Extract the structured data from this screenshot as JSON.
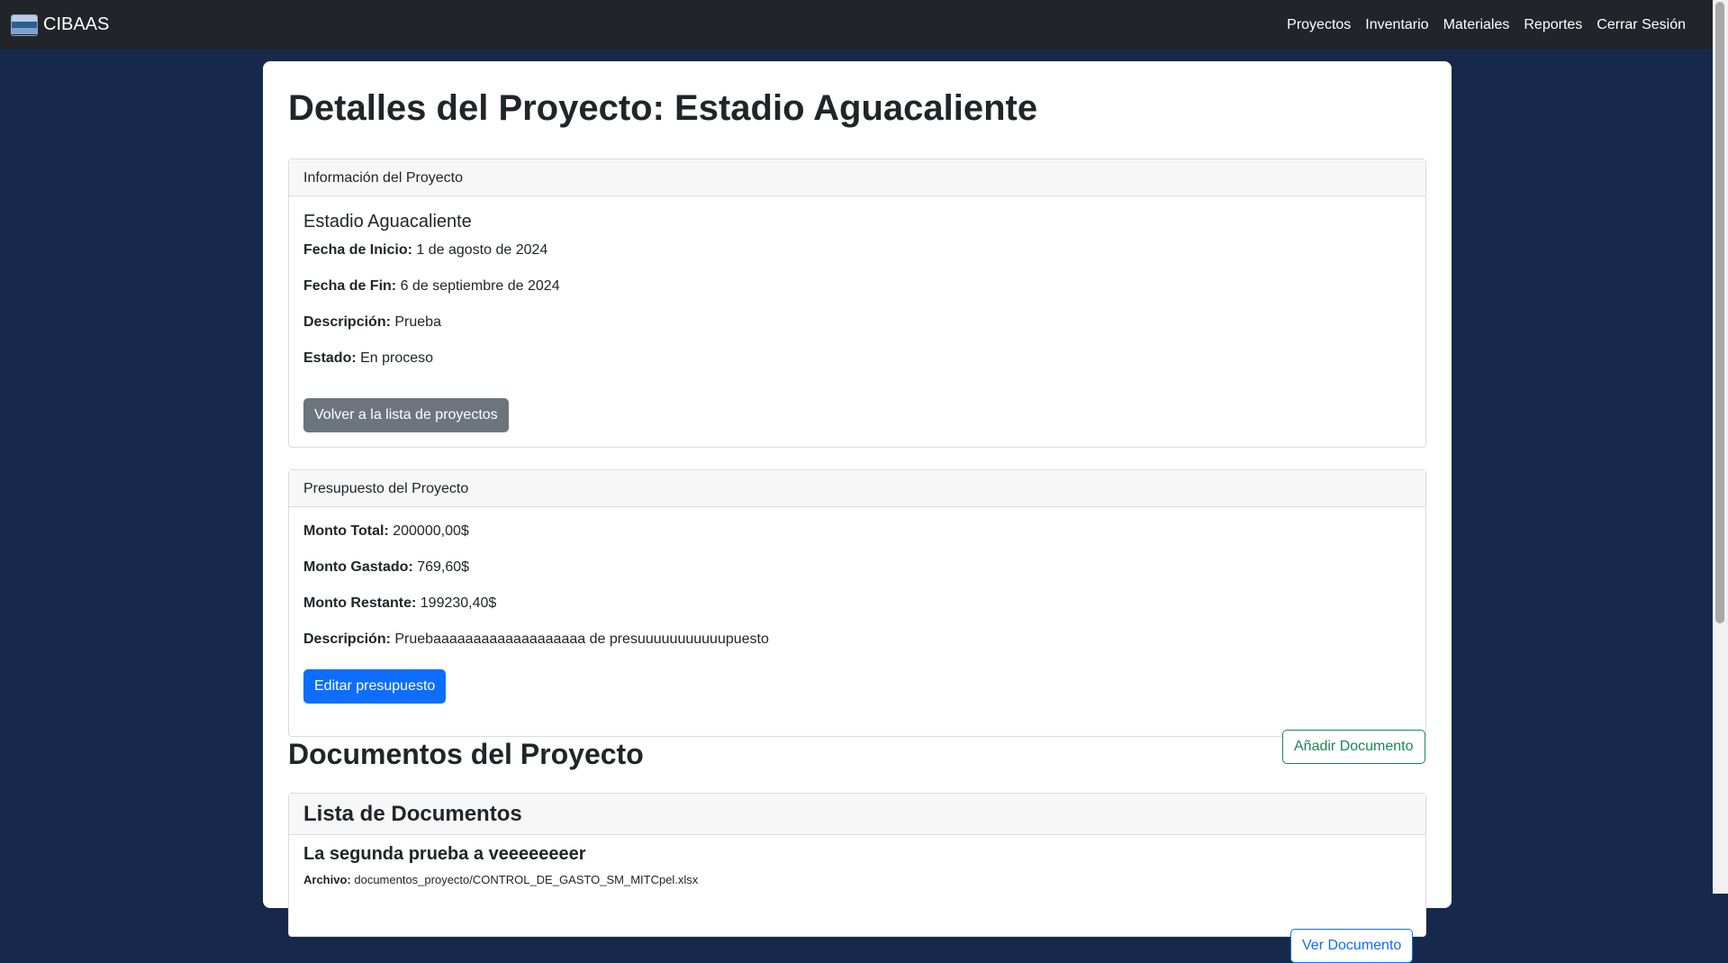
{
  "navbar": {
    "brand": "CIBAAS",
    "links": [
      "Proyectos",
      "Inventario",
      "Materiales",
      "Reportes",
      "Cerrar Sesión"
    ]
  },
  "page": {
    "title": "Detalles del Proyecto: Estadio Aguacaliente"
  },
  "info_card": {
    "header": "Información del Proyecto",
    "project_name": "Estadio Aguacaliente",
    "fields": [
      {
        "label": "Fecha de Inicio:",
        "value": "1 de agosto de 2024"
      },
      {
        "label": "Fecha de Fin:",
        "value": "6 de septiembre de 2024"
      },
      {
        "label": "Descripción:",
        "value": "Prueba"
      },
      {
        "label": "Estado:",
        "value": "En proceso"
      }
    ],
    "back_button": "Volver a la lista de proyectos"
  },
  "budget_card": {
    "header": "Presupuesto del Proyecto",
    "fields": [
      {
        "label": "Monto Total:",
        "value": "200000,00$"
      },
      {
        "label": "Monto Gastado:",
        "value": "769,60$"
      },
      {
        "label": "Monto Restante:",
        "value": "199230,40$"
      },
      {
        "label": "Descripción:",
        "value": "Pruebaaaaaaaaaaaaaaaaaaa de presuuuuuuuuuuupuesto"
      }
    ],
    "edit_button": "Editar presupuesto"
  },
  "documents": {
    "title": "Documentos del Proyecto",
    "add_button": "Añadir Documento",
    "list_header": "Lista de Documentos",
    "items": [
      {
        "title": "La segunda prueba a veeeeeeeer",
        "file_label": "Archivo:",
        "file_value": "documentos_proyecto/CONTROL_DE_GASTO_SM_MITCpel.xlsx",
        "view_button": "Ver Documento"
      }
    ]
  },
  "colors": {
    "background": "#16294b",
    "navbar": "#212529",
    "primary": "#0d6efd",
    "secondary": "#6c757d",
    "success": "#198754"
  }
}
